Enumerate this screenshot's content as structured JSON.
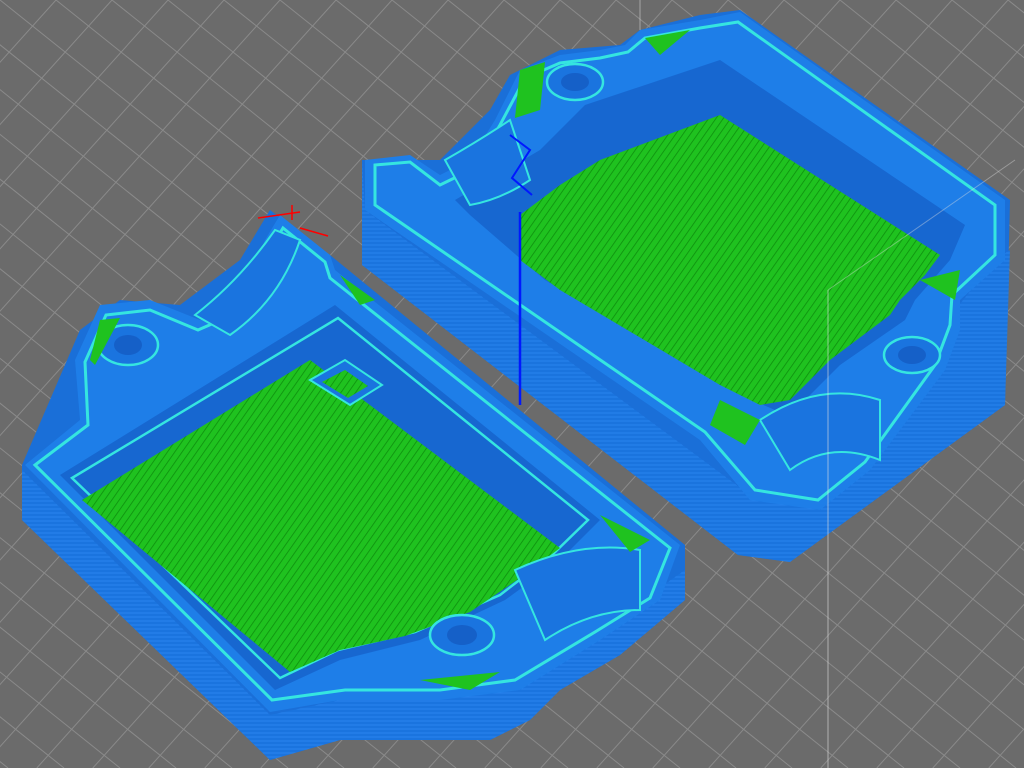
{
  "viewport": {
    "background": "#6b6b6b",
    "bed_grid_color": "#8a8a8a",
    "bed_grid_minor_color": "#7c7c7c"
  },
  "colors": {
    "perimeter_external": "#1a78e6",
    "perimeter_internal": "#1f6fd6",
    "infill_top": "#1fc21f",
    "infill_line": "#0e8f0e",
    "infill_highlight": "#2adf2a",
    "inner_perimeter_cyan": "#35e5e0",
    "travel": "#0018ff",
    "retract": "#ff0000"
  },
  "objects": [
    {
      "icon": "enclosure-lid-part"
    },
    {
      "icon": "enclosure-base-part"
    }
  ]
}
